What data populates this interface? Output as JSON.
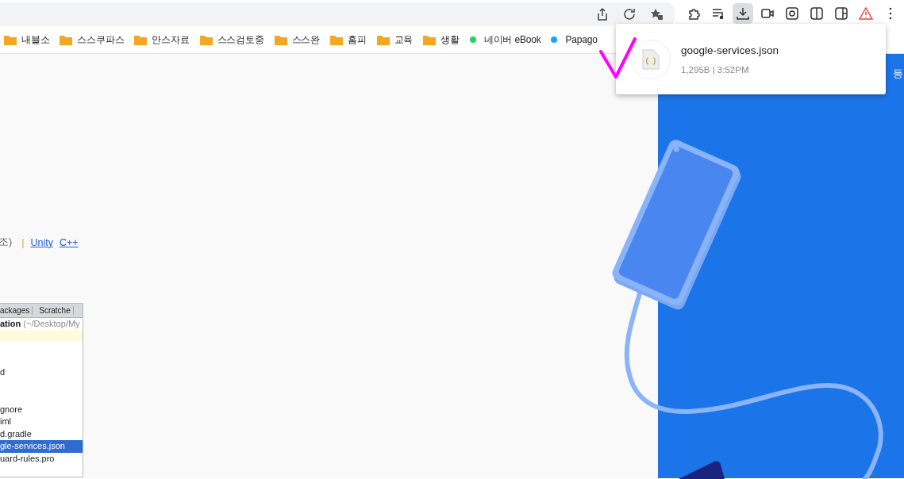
{
  "toolbar": {
    "omnibox_buttons": [
      {
        "kind": "share",
        "pressed": false
      },
      {
        "kind": "reload",
        "pressed": false
      },
      {
        "kind": "star",
        "pressed": false
      }
    ],
    "buttons": [
      {
        "kind": "puzzle",
        "pressed": false
      },
      {
        "kind": "playlist",
        "pressed": false
      },
      {
        "kind": "download",
        "pressed": true
      },
      {
        "kind": "video",
        "pressed": false
      },
      {
        "kind": "screenshot",
        "pressed": false
      },
      {
        "kind": "split",
        "pressed": false
      },
      {
        "kind": "sidebar",
        "pressed": false
      },
      {
        "kind": "warning",
        "pressed": false
      },
      {
        "kind": "menu",
        "pressed": false
      }
    ]
  },
  "bookmarks": [
    {
      "kind": "folder",
      "label": "내블소"
    },
    {
      "kind": "folder",
      "label": "스스쿠파스"
    },
    {
      "kind": "folder",
      "label": "안스자료"
    },
    {
      "kind": "folder",
      "label": "스스검토중"
    },
    {
      "kind": "folder",
      "label": "스스완"
    },
    {
      "kind": "folder",
      "label": "홈피"
    },
    {
      "kind": "folder",
      "label": "교육"
    },
    {
      "kind": "folder",
      "label": "생활"
    },
    {
      "kind": "site",
      "label": "네이버 eBook",
      "color": "#1ed760"
    },
    {
      "kind": "site",
      "label": "Papago",
      "color": "#1aa3ff"
    }
  ],
  "download_popup": {
    "file_name": "google-services.json",
    "meta": "1,295B | 3:52PM"
  },
  "content": {
    "fragment": "조)",
    "separator": "|",
    "links": [
      "Unity",
      "C++"
    ],
    "embedded_screenshot": {
      "tabs": [
        "ackages",
        "Scratche"
      ],
      "project_bold": "ation",
      "project_path": "(~/Desktop/My",
      "files": [
        {
          "label": "d",
          "selected": false
        },
        {
          "label": "gnore",
          "selected": false
        },
        {
          "label": "iml",
          "selected": false
        },
        {
          "label": "d.gradle",
          "selected": false
        },
        {
          "label": "gle-services.json",
          "selected": true
        },
        {
          "label": "uard-rules.pro",
          "selected": false
        }
      ]
    }
  },
  "hero": {
    "text": "등"
  }
}
